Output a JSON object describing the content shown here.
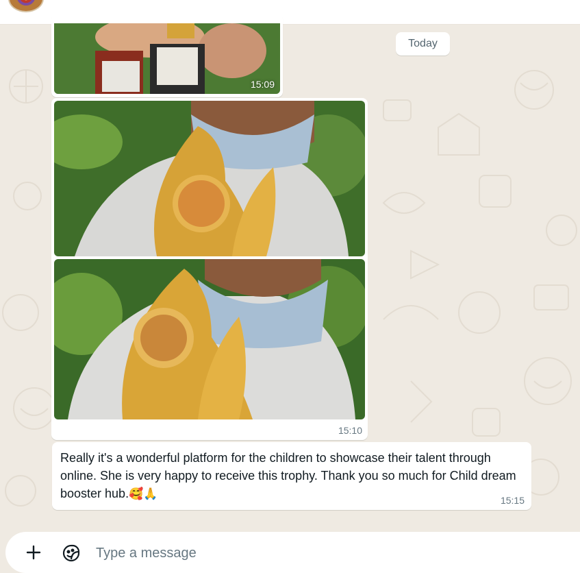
{
  "header": {
    "avatar_icon": "contact-avatar"
  },
  "chat": {
    "date_divider": "Today",
    "messages": [
      {
        "type": "image",
        "time": "15:09"
      },
      {
        "type": "image-album",
        "count": 2,
        "time": "15:10"
      },
      {
        "type": "text",
        "text": "Really it's a wonderful platform for the children to showcase their talent through online. She is very happy to receive this trophy. Thank you so much for Child dream booster hub.",
        "emoji": "🥰🙏",
        "time": "15:15"
      }
    ]
  },
  "composer": {
    "placeholder": "Type a message",
    "value": "",
    "attach_icon": "plus-icon",
    "sticker_icon": "sticker-icon"
  },
  "colors": {
    "background": "#efeae2",
    "bubble": "#ffffff",
    "timestamp": "#667781",
    "text": "#111b21"
  }
}
